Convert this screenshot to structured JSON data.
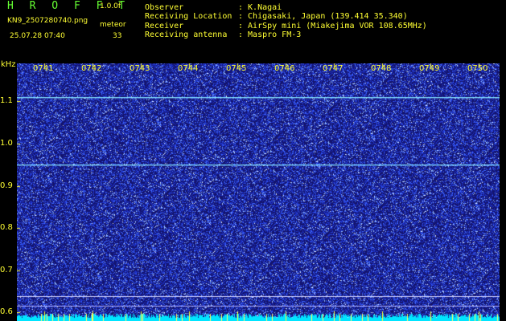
{
  "header": {
    "app_title": "H R O F F T",
    "version": "1.0.0f",
    "filename": "KN9_2507280740.png",
    "mode": "meteor",
    "timestamp": "25.07.28 07:40",
    "count": "33",
    "info": [
      {
        "key": "Observer",
        "value": ": K.Nagai"
      },
      {
        "key": "Receiving Location",
        "value": ": Chigasaki, Japan (139.414 35.340)"
      },
      {
        "key": "Receiver",
        "value": ": AirSpy mini (Miakejima VOR 108.65MHz)"
      },
      {
        "key": "Receiving antenna",
        "value": ": Maspro FM-3"
      }
    ]
  },
  "chart_data": {
    "type": "heatmap",
    "ylabel": "kHz",
    "y_ticks": [
      "1.1",
      "1.0",
      "0.9",
      "0.8",
      "0.7",
      "0.6"
    ],
    "x_ticks": [
      "0741",
      "0742",
      "0743",
      "0744",
      "0745",
      "0746",
      "0747",
      "0748",
      "0749",
      "0750"
    ],
    "ylim": [
      0.58,
      1.19
    ],
    "carrier_lines_khz": [
      1.11,
      0.95
    ],
    "colors": {
      "background": "#1a1a7a",
      "noise": "#4060ff",
      "carrier": "#80e0ff",
      "axis_text": "#ffff33"
    }
  }
}
